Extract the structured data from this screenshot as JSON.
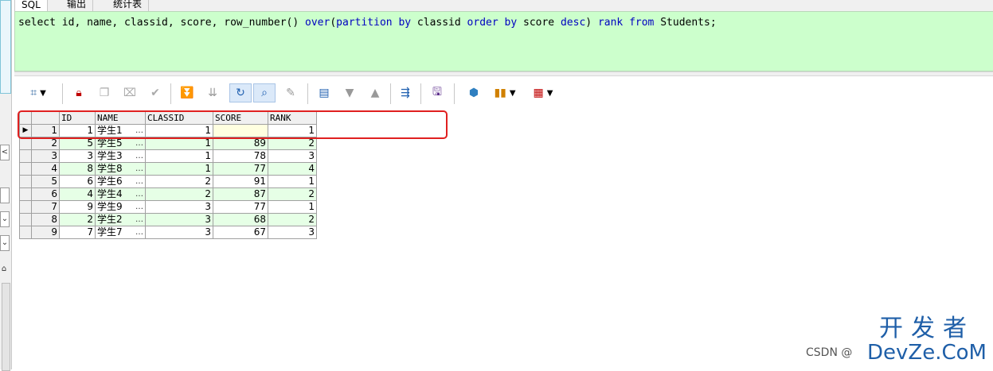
{
  "tabs": [
    "SQL",
    "输出",
    "统计表"
  ],
  "sql": {
    "text_parts": [
      {
        "t": "select id, name, classid, score, row_number() ",
        "kw": false
      },
      {
        "t": "over",
        "kw": true
      },
      {
        "t": "(",
        "kw": false
      },
      {
        "t": "partition by",
        "kw": true
      },
      {
        "t": " classid ",
        "kw": false
      },
      {
        "t": "order by",
        "kw": true
      },
      {
        "t": " score ",
        "kw": false
      },
      {
        "t": "desc",
        "kw": true
      },
      {
        "t": ") ",
        "kw": false
      },
      {
        "t": "rank",
        "kw": true
      },
      {
        "t": " ",
        "kw": false
      },
      {
        "t": "from",
        "kw": true
      },
      {
        "t": " Students;",
        "kw": false
      }
    ]
  },
  "toolbar_icons": [
    "grid-options-icon",
    "lock-icon",
    "copy-record-icon",
    "clear-record-icon",
    "post-changes-icon",
    "first-record-icon",
    "last-record-icon",
    "refresh-icon",
    "find-icon",
    "erase-icon",
    "query-by-example-icon",
    "sort-down-icon",
    "sort-up-icon",
    "link-icon",
    "save-icon",
    "export-icon",
    "chart-icon",
    "table-view-icon"
  ],
  "grid": {
    "columns": [
      "ID",
      "NAME",
      "CLASSID",
      "SCORE",
      "RANK"
    ],
    "rows": [
      {
        "rn": "1",
        "id": "1",
        "name": "学生1",
        "classid": "1",
        "score": "",
        "rank": "1"
      },
      {
        "rn": "2",
        "id": "5",
        "name": "学生5",
        "classid": "1",
        "score": "89",
        "rank": "2"
      },
      {
        "rn": "3",
        "id": "3",
        "name": "学生3",
        "classid": "1",
        "score": "78",
        "rank": "3"
      },
      {
        "rn": "4",
        "id": "8",
        "name": "学生8",
        "classid": "1",
        "score": "77",
        "rank": "4"
      },
      {
        "rn": "5",
        "id": "6",
        "name": "学生6",
        "classid": "2",
        "score": "91",
        "rank": "1"
      },
      {
        "rn": "6",
        "id": "4",
        "name": "学生4",
        "classid": "2",
        "score": "87",
        "rank": "2"
      },
      {
        "rn": "7",
        "id": "9",
        "name": "学生9",
        "classid": "3",
        "score": "77",
        "rank": "1"
      },
      {
        "rn": "8",
        "id": "2",
        "name": "学生2",
        "classid": "3",
        "score": "68",
        "rank": "2"
      },
      {
        "rn": "9",
        "id": "7",
        "name": "学生7",
        "classid": "3",
        "score": "67",
        "rank": "3"
      }
    ],
    "ellipsis": "…",
    "current_row_marker": "▶"
  },
  "watermark": {
    "devze_cn": "开发者",
    "devze_en": "DevZe.CoM",
    "csdn": "CSDN @"
  },
  "left_strip": {
    "btn1": "<",
    "btn2": "⌄",
    "btn3": "⌄",
    "btn4": "⌂"
  },
  "colors": {
    "editor_bg": "#ccffcc",
    "alt_row": "#e6ffe6",
    "highlight": "#e02020",
    "keyword": "#0000c0"
  }
}
